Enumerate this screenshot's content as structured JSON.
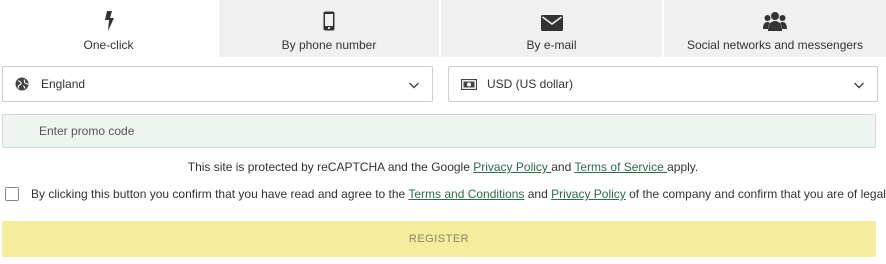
{
  "tabs": [
    {
      "label": "One-click",
      "icon": "lightning-icon",
      "active": true
    },
    {
      "label": "By phone number",
      "icon": "smartphone-icon",
      "active": false
    },
    {
      "label": "By e-mail",
      "icon": "envelope-icon",
      "active": false
    },
    {
      "label": "Social networks and messengers",
      "icon": "users-icon",
      "active": false
    }
  ],
  "country_select": {
    "value": "England",
    "icon": "globe-icon"
  },
  "currency_select": {
    "value": "USD (US dollar)",
    "icon": "banknote-icon"
  },
  "promo": {
    "placeholder": "Enter promo code",
    "value": ""
  },
  "recaptcha": {
    "prefix": "This site is protected by reCAPTCHA and the Google ",
    "privacy_link": "Privacy Policy ",
    "middle": "and ",
    "terms_link": "Terms of Service ",
    "suffix": "apply."
  },
  "agreement": {
    "checked": false,
    "prefix": "By clicking this button you confirm that you have read and agree to the ",
    "terms_link": "Terms and Conditions",
    "middle": " and ",
    "privacy_link": "Privacy Policy",
    "suffix": " of the company and confirm that you are of legal age"
  },
  "register_label": "REGISTER",
  "colors": {
    "accent_link": "#2c6b4e",
    "register_bg": "#f6ec9d",
    "promo_bg": "#eef5f0",
    "tab_bg": "#f0f0f0"
  }
}
